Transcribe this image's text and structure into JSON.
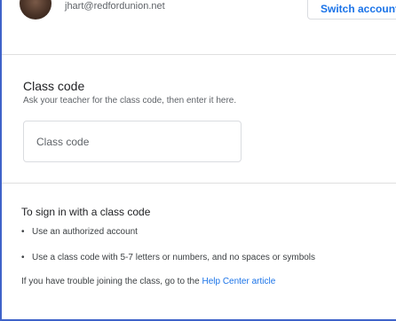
{
  "account": {
    "email": "jhart@redfordunion.net",
    "switch_label": "Switch account"
  },
  "class_code": {
    "title": "Class code",
    "description": "Ask your teacher for the class code, then enter it here.",
    "placeholder": "Class code"
  },
  "help": {
    "title": "To sign in with a class code",
    "bullets": [
      "Use an authorized account",
      "Use a class code with 5-7 letters or numbers, and no spaces or symbols"
    ],
    "trouble_text": "If you have trouble joining the class, go to the",
    "link_label": "Help Center article"
  },
  "colors": {
    "link": "#1a73e8",
    "frame": "#3f63c9"
  }
}
